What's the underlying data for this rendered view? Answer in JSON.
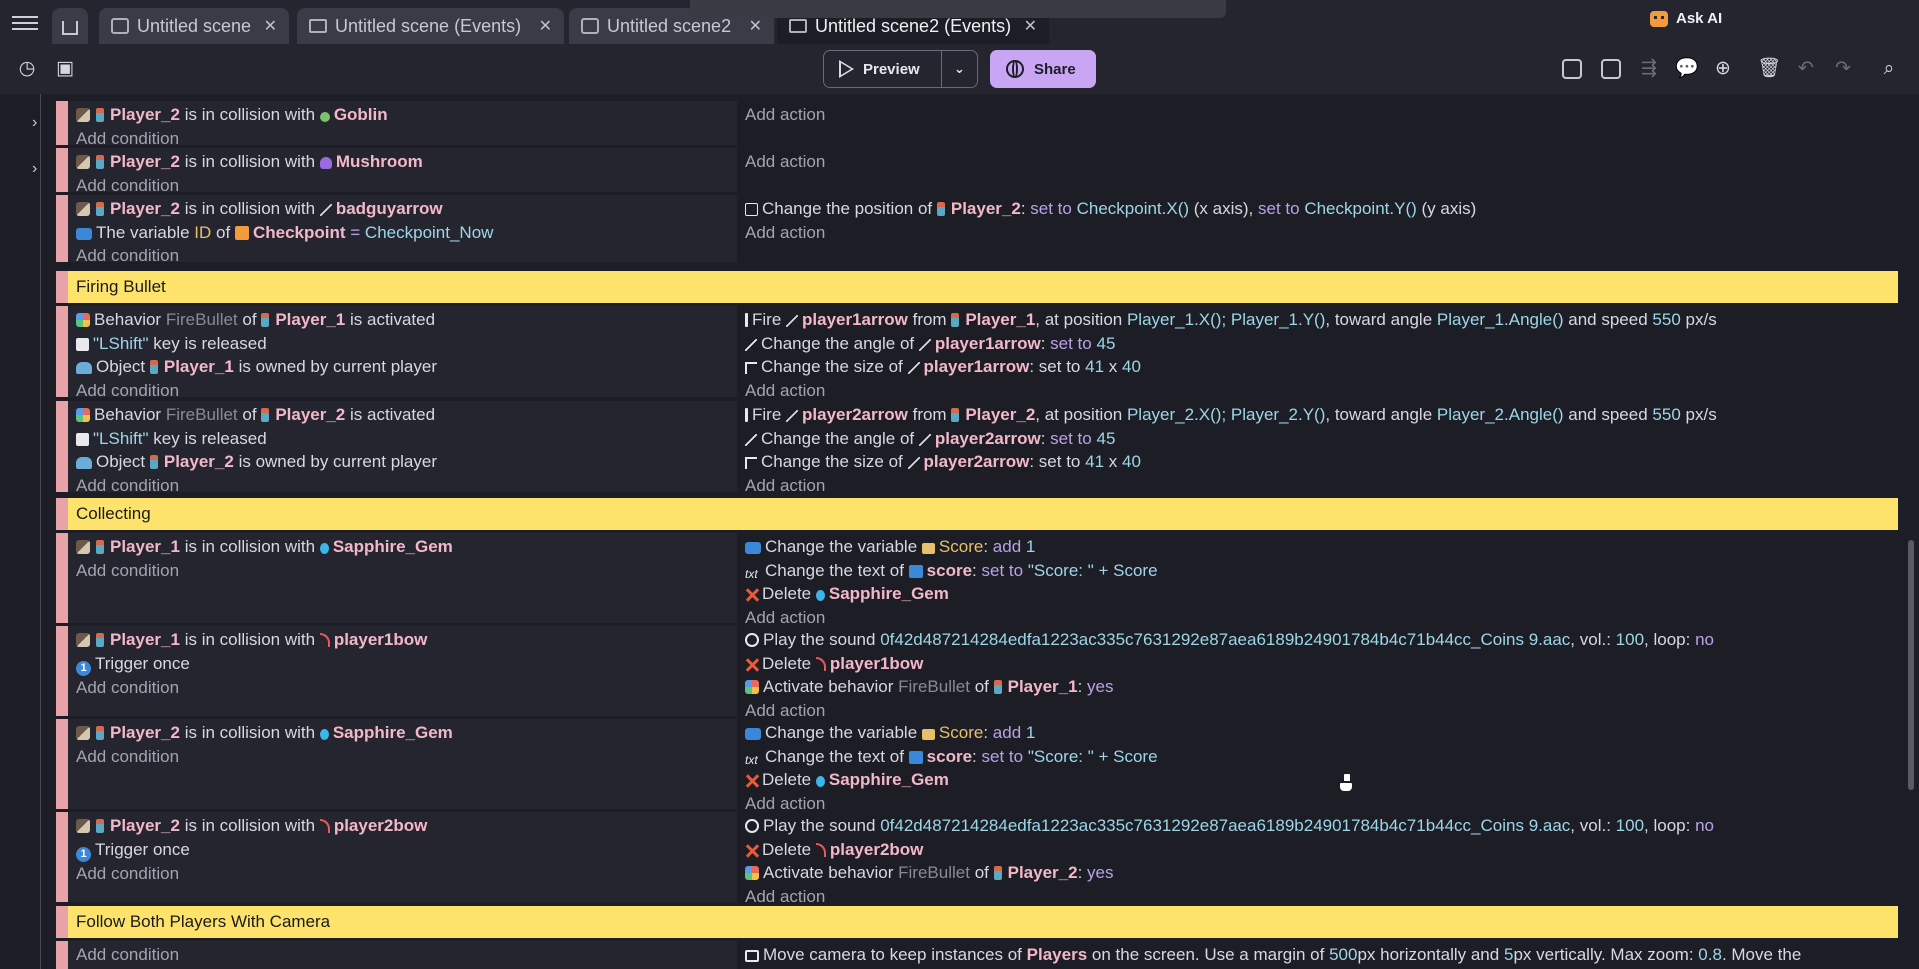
{
  "tabs": [
    {
      "label": "Untitled scene"
    },
    {
      "label": "Untitled scene (Events)"
    },
    {
      "label": "Untitled scene2"
    },
    {
      "label": "Untitled scene2 (Events)"
    }
  ],
  "header": {
    "ask_ai": "Ask AI"
  },
  "toolbar": {
    "preview": "Preview",
    "share": "Share"
  },
  "labels": {
    "add_condition": "Add condition",
    "add_action": "Add action",
    "in_collision": "is in collision with",
    "behavior": "Behavior",
    "of": "of",
    "is_activated": "is activated",
    "key_released": "key is released",
    "object": "Object",
    "owned": "is owned by current player",
    "fire": "Fire",
    "from": "from",
    "at_position": ", at position",
    "toward": ", toward angle",
    "and_speed": "and speed",
    "px_s": "px/s",
    "change_angle": "Change the angle of",
    "change_size": "Change the size of",
    "set_to": "set to",
    "change_var": "Change the variable",
    "add": "add",
    "change_text": "Change the text of",
    "delete": "Delete",
    "play_sound": "Play the sound",
    "vol": ", vol.:",
    "loop": ", loop:",
    "trigger_once": "Trigger once",
    "activate_behavior": "Activate behavior",
    "yes": "yes",
    "no": "no",
    "change_pos": "Change the position of",
    "x_axis": "(x axis),",
    "y_axis": "(y axis)",
    "the_variable": "The variable"
  },
  "objects": {
    "p1": "Player_1",
    "p2": "Player_2",
    "goblin": "Goblin",
    "mushroom": "Mushroom",
    "badguyarrow": "badguyarrow",
    "checkpoint": "Checkpoint",
    "p1arrow": "player1arrow",
    "p2arrow": "player2arrow",
    "gem": "Sapphire_Gem",
    "score_obj": "score",
    "p1bow": "player1bow",
    "p2bow": "player2bow",
    "players": "Players"
  },
  "values": {
    "firebullet": "FireBullet",
    "lshift": "\"LShift\"",
    "angle": "45",
    "w": "41",
    "x": "x",
    "h": "40",
    "speed": "550",
    "p1pos": "Player_1.X(); Player_1.Y()",
    "p1angle": "Player_1.Angle()",
    "p2pos": "Player_2.X(); Player_2.Y()",
    "p2angle": "Player_2.Angle()",
    "score_var": "Score",
    "one": "1",
    "score_text": "\"Score: \" + Score",
    "sound_file": "0f42d487214284edfa1223ac335c7631292e87aea6189b24901784b4c71b44cc_Coins 9.aac",
    "vol_val": "100",
    "id_var": "ID",
    "eq": "=",
    "checkpoint_now": "Checkpoint_Now",
    "cpx": "Checkpoint.X()",
    "cpy": "Checkpoint.Y()"
  },
  "comments": {
    "firing": "Firing Bullet",
    "collecting": "Collecting",
    "camera": "Follow Both Players With Camera"
  },
  "camera_action": "Move camera to keep instances of",
  "camera_rest": {
    "a": "on the screen. Use a margin of",
    "b": "500",
    "c": "px horizontally and",
    "d": "5",
    "e": "px vertically. Max zoom:",
    "f": "0.8",
    "g": ". Move the"
  }
}
